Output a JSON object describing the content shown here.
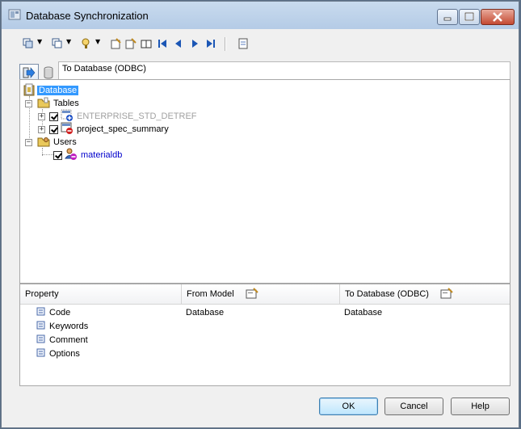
{
  "window": {
    "title": "Database Synchronization"
  },
  "target": {
    "label": "To Database (ODBC)"
  },
  "tree": {
    "root": {
      "label": "Database"
    },
    "tables": {
      "label": "Tables",
      "items": [
        {
          "label": "ENTERPRISE_STD_DETREF",
          "color": "#a0a0a0"
        },
        {
          "label": "project_spec_summary",
          "color": "#000000"
        }
      ]
    },
    "users": {
      "label": "Users",
      "items": [
        {
          "label": "materialdb",
          "color": "#0000cc"
        }
      ]
    }
  },
  "properties": {
    "headers": {
      "property": "Property",
      "from_model": "From Model",
      "to_database": "To Database (ODBC)"
    },
    "rows": [
      {
        "name": "Code",
        "from": "Database",
        "to": "Database"
      },
      {
        "name": "Keywords",
        "from": "",
        "to": ""
      },
      {
        "name": "Comment",
        "from": "",
        "to": ""
      },
      {
        "name": "Options",
        "from": "",
        "to": ""
      }
    ]
  },
  "buttons": {
    "ok": "OK",
    "cancel": "Cancel",
    "help": "Help"
  }
}
